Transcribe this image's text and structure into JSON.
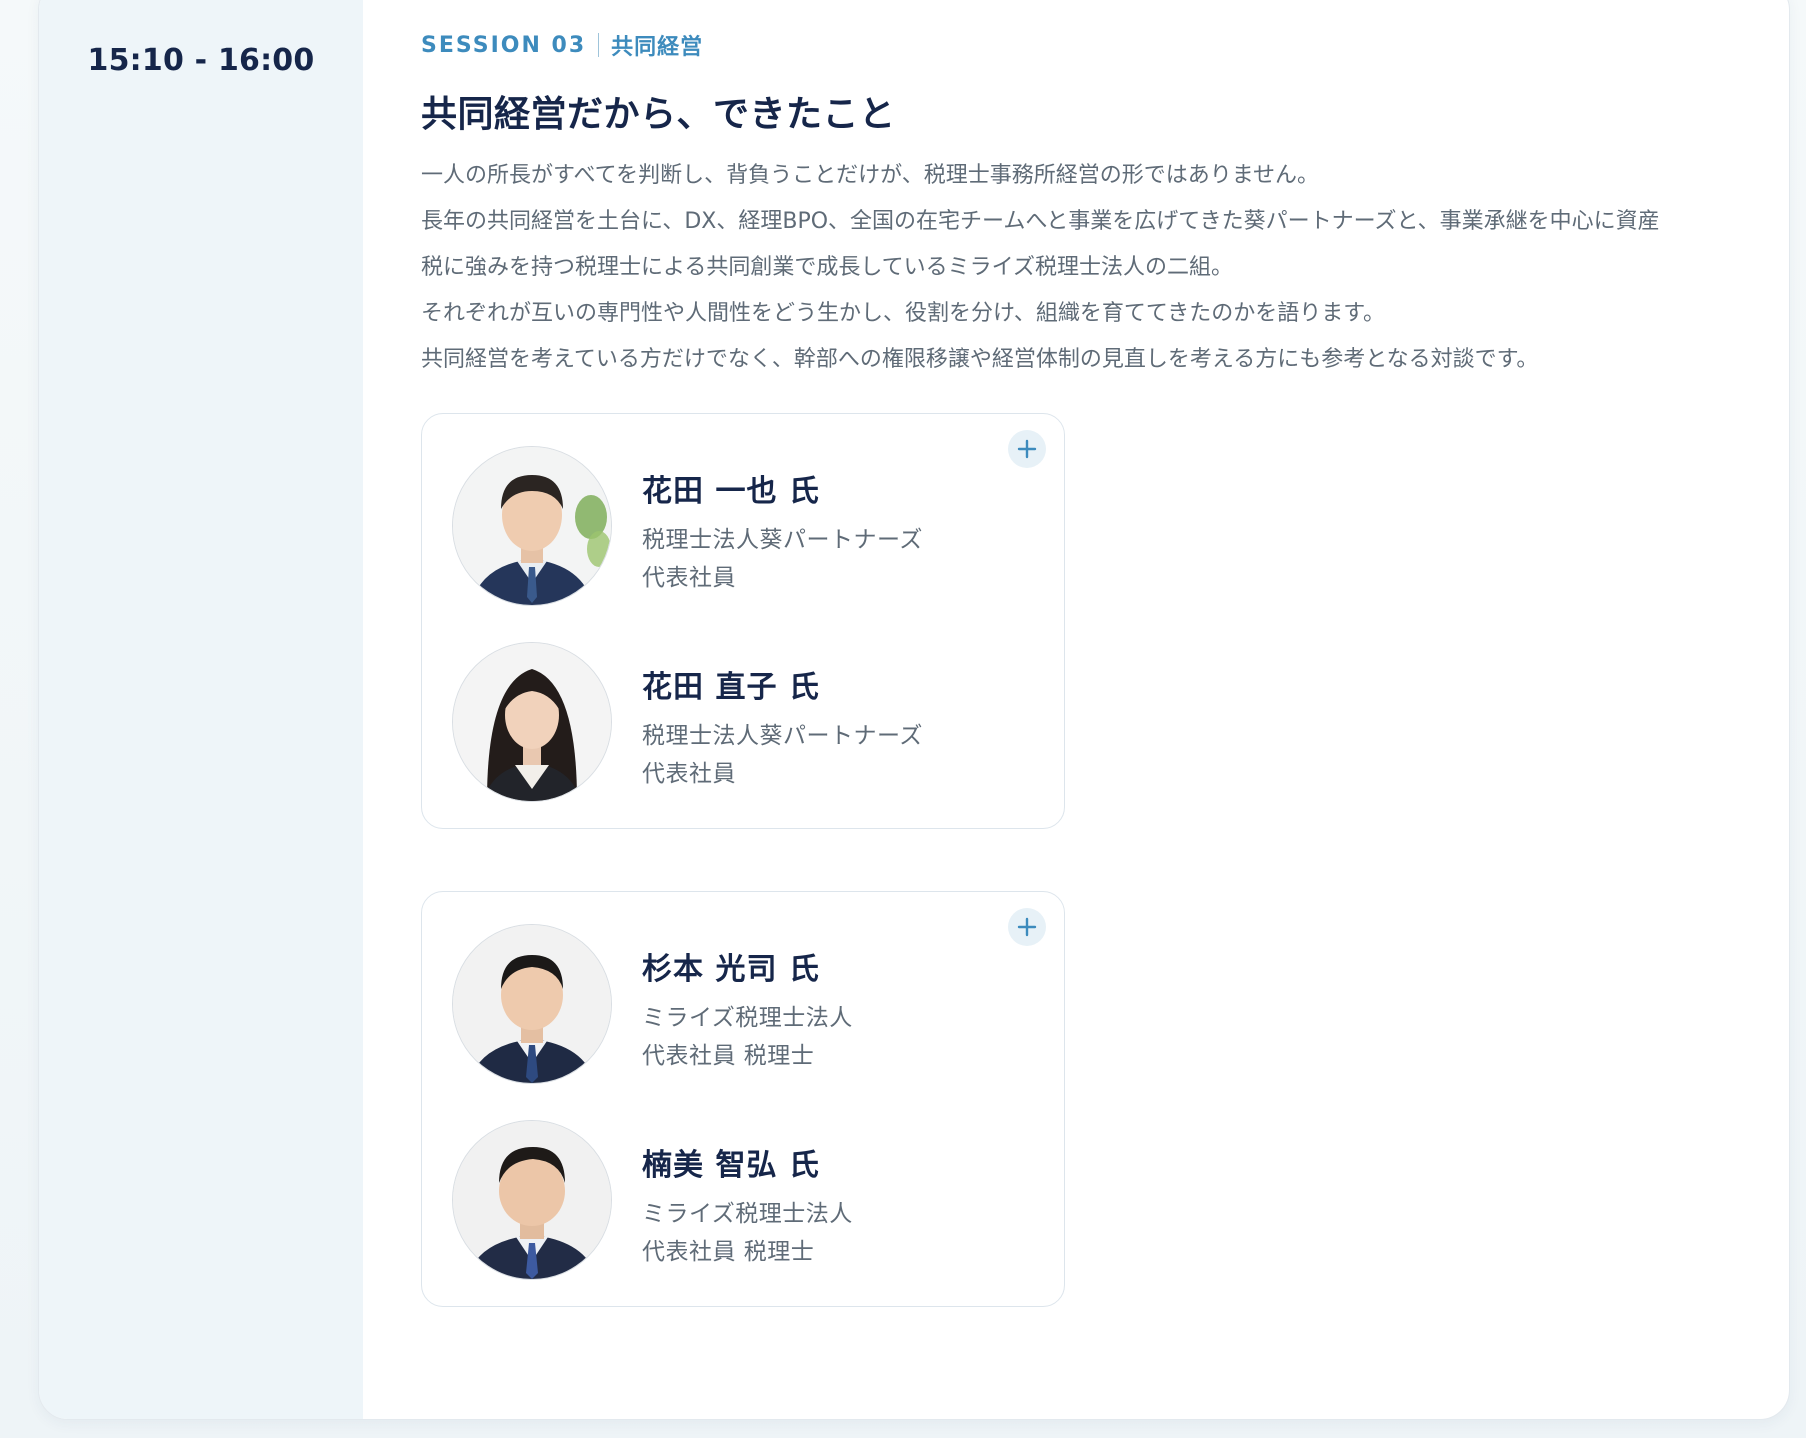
{
  "session": {
    "time": "15:10 - 16:00",
    "label": "SESSION 03",
    "topic": "共同経営",
    "title": "共同経営だから、できたこと",
    "description": [
      "一人の所長がすべてを判断し、背負うことだけが、税理士事務所経営の形ではありません。",
      "長年の共同経営を土台に、DX、経理BPO、全国の在宅チームへと事業を広げてきた葵パートナーズと、事業承継を中心に資産",
      "税に強みを持つ税理士による共同創業で成長しているミライズ税理士法人の二組。",
      "それぞれが互いの専門性や人間性をどう生かし、役割を分け、組織を育ててきたのかを語ります。",
      "共同経営を考えている方だけでなく、幹部への権限移譲や経営体制の見直しを考える方にも参考となる対談です。"
    ]
  },
  "speaker_groups": [
    {
      "expand_icon": "plus-icon",
      "speakers": [
        {
          "name": "花田 一也 氏",
          "org": "税理士法人葵パートナーズ",
          "role": "代表社員"
        },
        {
          "name": "花田 直子 氏",
          "org": "税理士法人葵パートナーズ",
          "role": "代表社員"
        }
      ]
    },
    {
      "expand_icon": "plus-icon",
      "speakers": [
        {
          "name": "杉本 光司 氏",
          "org": "ミライズ税理士法人",
          "role": "代表社員 税理士"
        },
        {
          "name": "楠美 智弘 氏",
          "org": "ミライズ税理士法人",
          "role": "代表社員 税理士"
        }
      ]
    }
  ],
  "colors": {
    "accent": "#3d8bbd",
    "heading": "#16264a",
    "body_text": "#5f6b77",
    "time_column_bg": "#eef5f9"
  }
}
